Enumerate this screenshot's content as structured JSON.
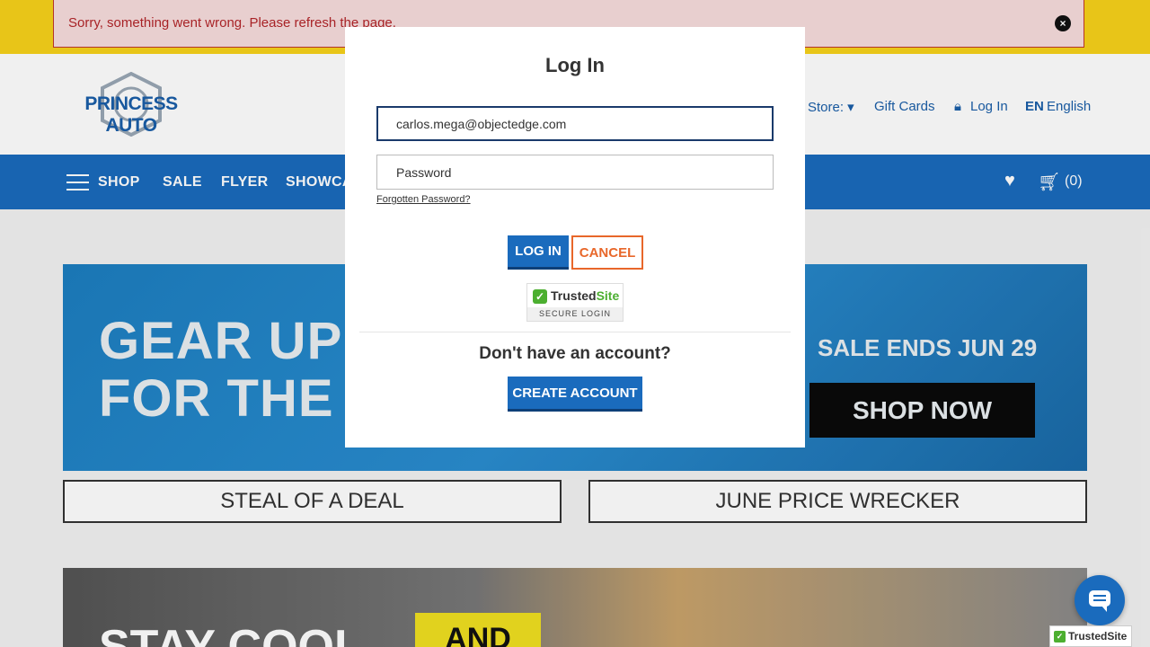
{
  "error_banner": {
    "message": "Sorry, something went wrong. Please refresh the page.",
    "close_icon": "close-circle-icon"
  },
  "header": {
    "logo_text": "PRINCESS AUTO",
    "store_label": "Store: ▾",
    "gift_cards": "Gift Cards",
    "login": "Log In",
    "lang_code": "EN",
    "lang_name": "English"
  },
  "nav": {
    "items": [
      "SHOP",
      "SALE",
      "FLYER",
      "SHOWCA"
    ],
    "cart_count": "(0)"
  },
  "banner": {
    "line1": "GEAR UP",
    "line2": "FOR THE",
    "sale_ends": "SALE ENDS JUN 29",
    "shop_now": "SHOP NOW"
  },
  "promos": {
    "steal": "STEAL OF A DEAL",
    "wrecker": "JUNE PRICE WRECKER"
  },
  "banner2": {
    "text": "STAY COOL",
    "and": "AND"
  },
  "modal": {
    "title": "Log In",
    "email_value": "carlos.mega@objectedge.com",
    "password_placeholder": "Password",
    "forgot": "Forgotten Password?",
    "login_button": "LOG IN",
    "cancel_button": "CANCEL",
    "trusted_name_a": "Trusted",
    "trusted_name_b": "Site",
    "trusted_sub": "SECURE LOGIN",
    "no_account": "Don't have an account?",
    "create_button": "CREATE ACCOUNT"
  },
  "trusted_corner": "TrustedSite",
  "colors": {
    "brand_blue": "#1a6bbd",
    "accent_orange": "#e8672a",
    "error_red": "#b3262a",
    "warning_yellow": "#f7d21a"
  }
}
